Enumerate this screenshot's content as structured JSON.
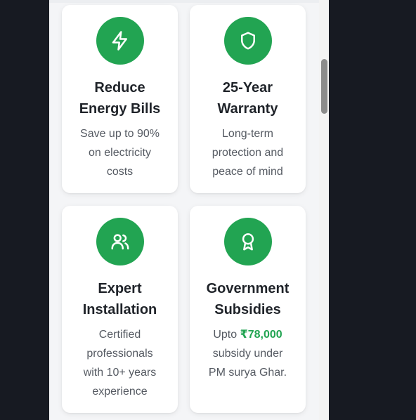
{
  "colors": {
    "accent": "#22a452",
    "page_background": "#171a22",
    "content_background": "#f4f5f7",
    "card_background": "#ffffff",
    "title_text": "#1f2329",
    "body_text": "#555a62"
  },
  "features": [
    {
      "icon": "lightning-icon",
      "title_line1": "Reduce",
      "title_line2": "Energy Bills",
      "desc_lines": [
        "Save up to 90%",
        "on electricity",
        "costs"
      ]
    },
    {
      "icon": "shield-icon",
      "title_line1": "25-Year",
      "title_line2": "Warranty",
      "desc_lines": [
        "Long-term",
        "protection and",
        "peace of mind"
      ]
    },
    {
      "icon": "users-icon",
      "title_line1": "Expert",
      "title_line2": "Installation",
      "desc_lines": [
        "Certified",
        "professionals",
        "with 10+ years",
        "experience"
      ]
    },
    {
      "icon": "award-icon",
      "title_line1": "Government",
      "title_line2": "Subsidies",
      "desc_prefix": "Upto ",
      "desc_highlight": "₹78,000",
      "desc_lines": [
        "subsidy under",
        "PM surya Ghar."
      ]
    }
  ]
}
